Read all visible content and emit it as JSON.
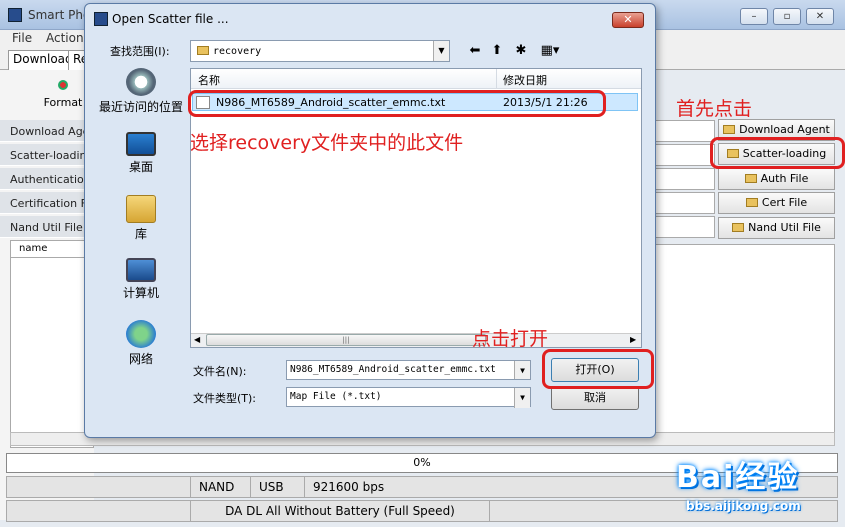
{
  "main_window": {
    "title": "Smart Pho",
    "menus": [
      "File",
      "Action"
    ],
    "tabs": [
      "Download",
      "Re"
    ],
    "format_label": "Format",
    "row_labels": [
      "Download Agen",
      "Scatter-loading",
      "Authentication F",
      "Certification File",
      "Nand Util File"
    ],
    "list_header": "name",
    "right_buttons": [
      "Download Agent",
      "Scatter-loading",
      "Auth File",
      "Cert File",
      "Nand Util File"
    ],
    "progress": "0%",
    "progress_fraction": 0,
    "status": {
      "nand": "NAND",
      "usb": "USB",
      "baud": "921600 bps"
    },
    "status2": "DA DL All Without Battery (Full Speed)",
    "win_buttons": [
      "–",
      "▫",
      "✕"
    ]
  },
  "dialog": {
    "title": "Open Scatter file ...",
    "close": "✕",
    "look_in_label": "查找范围(I):",
    "look_in_value": "recovery",
    "places": [
      "最近访问的位置",
      "桌面",
      "库",
      "计算机",
      "网络"
    ],
    "columns": {
      "name": "名称",
      "date": "修改日期"
    },
    "file": {
      "name": "N986_MT6589_Android_scatter_emmc.txt",
      "date": "2013/5/1 21:26"
    },
    "filename_label": "文件名(N):",
    "filename_value": "N986_MT6589_Android_scatter_emmc.txt",
    "filetype_label": "文件类型(T):",
    "filetype_value": "Map File (*.txt)",
    "open_button": "打开(O)",
    "cancel_button": "取消"
  },
  "annotations": {
    "select_file": "选择recovery文件夹中的此文件",
    "click_first": "首先点击",
    "click_open": "点击打开",
    "accent_color": "#e02020"
  },
  "watermark": {
    "text": "Bai经验",
    "url": "bbs.aijikong.com"
  }
}
